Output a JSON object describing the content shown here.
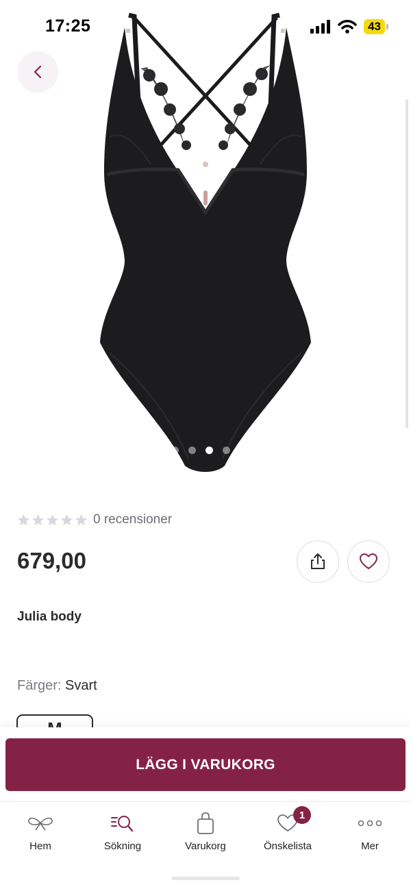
{
  "status_bar": {
    "time": "17:25",
    "battery": "43"
  },
  "product": {
    "image_alt": "Julia body",
    "carousel": {
      "count": 4,
      "active_index": 2
    },
    "rating": {
      "stars": 0,
      "max": 5,
      "text": "0 recensioner"
    },
    "price": "679,00",
    "name": "Julia body",
    "colors_label": "Färger:",
    "color_value": "Svart",
    "size": "M"
  },
  "actions": {
    "add_to_cart": "LÄGG I VARUKORG"
  },
  "tab_bar": {
    "items": [
      {
        "label": "Hem",
        "icon": "bow-icon"
      },
      {
        "label": "Sökning",
        "icon": "search-icon"
      },
      {
        "label": "Varukorg",
        "icon": "bag-icon"
      },
      {
        "label": "Önskelista",
        "icon": "heart-icon",
        "badge": "1"
      },
      {
        "label": "Mer",
        "icon": "more-icon"
      }
    ]
  },
  "colors": {
    "accent": "#842245",
    "text": "#2b2b2b",
    "muted": "#7a7a82"
  }
}
